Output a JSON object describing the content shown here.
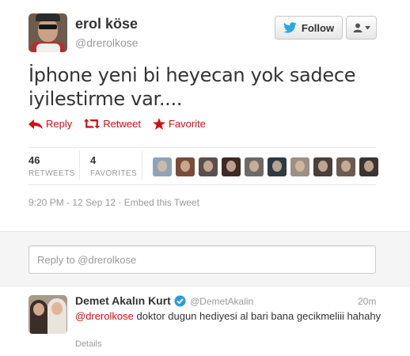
{
  "author": {
    "display_name": "erol köse",
    "handle": "@drerolkose"
  },
  "follow_button": {
    "label": "Follow"
  },
  "tweet": {
    "text": "İphone yeni bi heyecan yok sadece iyilestirme var....",
    "timestamp": "9:20 PM - 12 Sep 12",
    "separator": " · ",
    "embed_label": "Embed this Tweet"
  },
  "actions": {
    "reply": "Reply",
    "retweet": "Retweet",
    "favorite": "Favorite"
  },
  "stats": {
    "retweets": {
      "count": "46",
      "label": "RETWEETS"
    },
    "favorites": {
      "count": "4",
      "label": "FAVORITES"
    }
  },
  "faces": [
    {
      "icon": "user-face-icon",
      "color": "#8fa3b6"
    },
    {
      "icon": "user-face-icon",
      "color": "#7a4b3a"
    },
    {
      "icon": "user-face-icon",
      "color": "#5a4f4a"
    },
    {
      "icon": "user-face-icon",
      "color": "#3d2a24"
    },
    {
      "icon": "user-face-icon",
      "color": "#6e6a66"
    },
    {
      "icon": "user-face-icon",
      "color": "#2f3a44"
    },
    {
      "icon": "user-face-icon",
      "color": "#9c8f86"
    },
    {
      "icon": "user-face-icon",
      "color": "#4b3f3a"
    },
    {
      "icon": "user-face-icon",
      "color": "#6b5a50"
    },
    {
      "icon": "user-face-icon",
      "color": "#3a3530"
    }
  ],
  "reply_box": {
    "placeholder": "Reply to @drerolkose"
  },
  "reply_tweet": {
    "display_name": "Demet Akalın Kurt",
    "handle": "@DemetAkalin",
    "time": "20m",
    "mention": "@drerolkose",
    "text": " doktor dugun hediyesi al bari bana gecikmeliii hahahy",
    "details_label": "Details"
  },
  "colors": {
    "action_red": "#d40d12",
    "verified_blue": "#2b9bda",
    "twitter_blue": "#2aa9e0"
  }
}
